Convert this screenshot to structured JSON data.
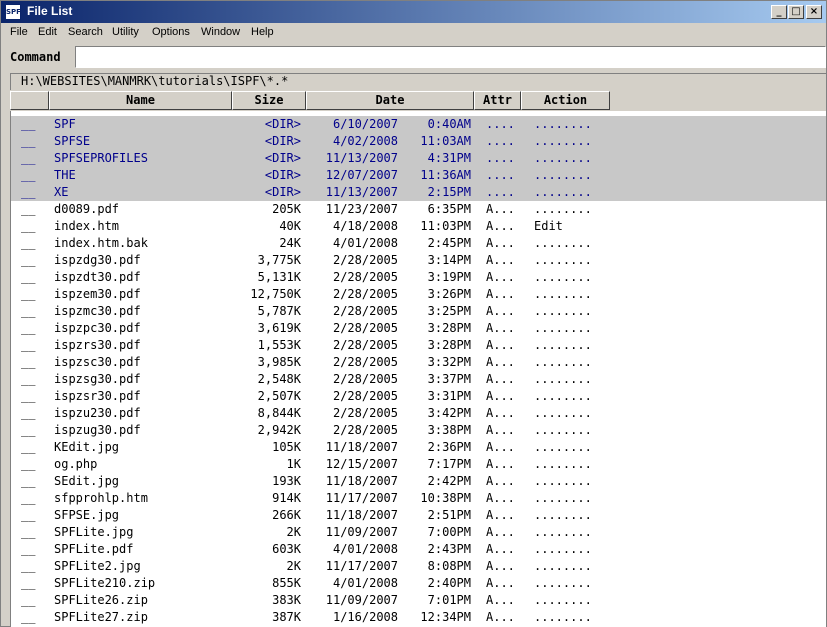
{
  "window": {
    "icon_text": "SPF",
    "title": "File List",
    "controls": {
      "minimize": "_",
      "maximize": "□",
      "close": "×"
    }
  },
  "menu": [
    "File",
    "Edit",
    "Search",
    "Utility",
    "Options",
    "Window",
    "Help"
  ],
  "command": {
    "label": "Command",
    "value": ""
  },
  "path": "H:\\WEBSITES\\MANMRK\\tutorials\\ISPF\\*.*",
  "columns": {
    "name": "Name",
    "size": "Size",
    "date": "Date",
    "attr": "Attr",
    "action": "Action"
  },
  "files": [
    {
      "sel": "__",
      "name": "SPF",
      "size": "<DIR>",
      "date": "6/10/2007",
      "time": "0:40AM",
      "attr": "....",
      "action": "........",
      "is_dir": true
    },
    {
      "sel": "__",
      "name": "SPFSE",
      "size": "<DIR>",
      "date": "4/02/2008",
      "time": "11:03AM",
      "attr": "....",
      "action": "........",
      "is_dir": true
    },
    {
      "sel": "__",
      "name": "SPFSEPROFILES",
      "size": "<DIR>",
      "date": "11/13/2007",
      "time": "4:31PM",
      "attr": "....",
      "action": "........",
      "is_dir": true
    },
    {
      "sel": "__",
      "name": "THE",
      "size": "<DIR>",
      "date": "12/07/2007",
      "time": "11:36AM",
      "attr": "....",
      "action": "........",
      "is_dir": true
    },
    {
      "sel": "__",
      "name": "XE",
      "size": "<DIR>",
      "date": "11/13/2007",
      "time": "2:15PM",
      "attr": "....",
      "action": "........",
      "is_dir": true
    },
    {
      "sel": "__",
      "name": "d0089.pdf",
      "size": "205K",
      "date": "11/23/2007",
      "time": "6:35PM",
      "attr": "A...",
      "action": "........"
    },
    {
      "sel": "__",
      "name": "index.htm",
      "size": "40K",
      "date": "4/18/2008",
      "time": "11:03PM",
      "attr": "A...",
      "action": "Edit"
    },
    {
      "sel": "__",
      "name": "index.htm.bak",
      "size": "24K",
      "date": "4/01/2008",
      "time": "2:45PM",
      "attr": "A...",
      "action": "........"
    },
    {
      "sel": "__",
      "name": "ispzdg30.pdf",
      "size": "3,775K",
      "date": "2/28/2005",
      "time": "3:14PM",
      "attr": "A...",
      "action": "........"
    },
    {
      "sel": "__",
      "name": "ispzdt30.pdf",
      "size": "5,131K",
      "date": "2/28/2005",
      "time": "3:19PM",
      "attr": "A...",
      "action": "........"
    },
    {
      "sel": "__",
      "name": "ispzem30.pdf",
      "size": "12,750K",
      "date": "2/28/2005",
      "time": "3:26PM",
      "attr": "A...",
      "action": "........"
    },
    {
      "sel": "__",
      "name": "ispzmc30.pdf",
      "size": "5,787K",
      "date": "2/28/2005",
      "time": "3:25PM",
      "attr": "A...",
      "action": "........"
    },
    {
      "sel": "__",
      "name": "ispzpc30.pdf",
      "size": "3,619K",
      "date": "2/28/2005",
      "time": "3:28PM",
      "attr": "A...",
      "action": "........"
    },
    {
      "sel": "__",
      "name": "ispzrs30.pdf",
      "size": "1,553K",
      "date": "2/28/2005",
      "time": "3:28PM",
      "attr": "A...",
      "action": "........"
    },
    {
      "sel": "__",
      "name": "ispzsc30.pdf",
      "size": "3,985K",
      "date": "2/28/2005",
      "time": "3:32PM",
      "attr": "A...",
      "action": "........"
    },
    {
      "sel": "__",
      "name": "ispzsg30.pdf",
      "size": "2,548K",
      "date": "2/28/2005",
      "time": "3:37PM",
      "attr": "A...",
      "action": "........"
    },
    {
      "sel": "__",
      "name": "ispzsr30.pdf",
      "size": "2,507K",
      "date": "2/28/2005",
      "time": "3:31PM",
      "attr": "A...",
      "action": "........"
    },
    {
      "sel": "__",
      "name": "ispzu230.pdf",
      "size": "8,844K",
      "date": "2/28/2005",
      "time": "3:42PM",
      "attr": "A...",
      "action": "........"
    },
    {
      "sel": "__",
      "name": "ispzug30.pdf",
      "size": "2,942K",
      "date": "2/28/2005",
      "time": "3:38PM",
      "attr": "A...",
      "action": "........"
    },
    {
      "sel": "__",
      "name": "KEdit.jpg",
      "size": "105K",
      "date": "11/18/2007",
      "time": "2:36PM",
      "attr": "A...",
      "action": "........"
    },
    {
      "sel": "__",
      "name": "og.php",
      "size": "1K",
      "date": "12/15/2007",
      "time": "7:17PM",
      "attr": "A...",
      "action": "........"
    },
    {
      "sel": "__",
      "name": "SEdit.jpg",
      "size": "193K",
      "date": "11/18/2007",
      "time": "2:42PM",
      "attr": "A...",
      "action": "........"
    },
    {
      "sel": "__",
      "name": "sfpprohlp.htm",
      "size": "914K",
      "date": "11/17/2007",
      "time": "10:38PM",
      "attr": "A...",
      "action": "........"
    },
    {
      "sel": "__",
      "name": "SFPSE.jpg",
      "size": "266K",
      "date": "11/18/2007",
      "time": "2:51PM",
      "attr": "A...",
      "action": "........"
    },
    {
      "sel": "__",
      "name": "SPFLite.jpg",
      "size": "2K",
      "date": "11/09/2007",
      "time": "7:00PM",
      "attr": "A...",
      "action": "........"
    },
    {
      "sel": "__",
      "name": "SPFLite.pdf",
      "size": "603K",
      "date": "4/01/2008",
      "time": "2:43PM",
      "attr": "A...",
      "action": "........"
    },
    {
      "sel": "__",
      "name": "SPFLite2.jpg",
      "size": "2K",
      "date": "11/17/2007",
      "time": "8:08PM",
      "attr": "A...",
      "action": "........"
    },
    {
      "sel": "__",
      "name": "SPFLite210.zip",
      "size": "855K",
      "date": "4/01/2008",
      "time": "2:40PM",
      "attr": "A...",
      "action": "........"
    },
    {
      "sel": "__",
      "name": "SPFLite26.zip",
      "size": "383K",
      "date": "11/09/2007",
      "time": "7:01PM",
      "attr": "A...",
      "action": "........"
    },
    {
      "sel": "__",
      "name": "SPFLite27.zip",
      "size": "387K",
      "date": "1/16/2008",
      "time": "12:34PM",
      "attr": "A...",
      "action": "........"
    }
  ]
}
